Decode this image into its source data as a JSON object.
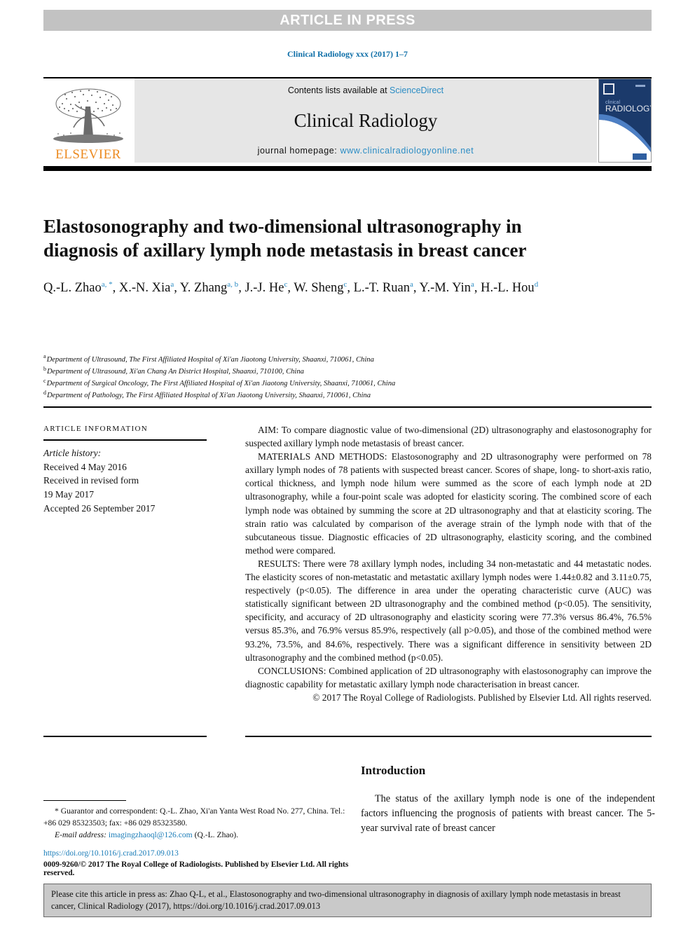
{
  "banner": {
    "text": "ARTICLE IN PRESS"
  },
  "running_head": "Clinical Radiology xxx (2017) 1–7",
  "masthead": {
    "publisher_name": "ELSEVIER",
    "contents_prefix": "Contents lists available at ",
    "contents_link": "ScienceDirect",
    "journal_name": "Clinical Radiology",
    "homepage_prefix": "journal homepage: ",
    "homepage_link": "www.clinicalradiologyonline.net",
    "cover": {
      "line1": "clinical",
      "line2": "RADIOLOGY"
    },
    "link_color": "#2b8cc4",
    "elsevier_orange": "#ec8b22",
    "cover_navy": "#1b3a6b"
  },
  "article": {
    "title": "Elastosonography and two-dimensional ultrasonography in diagnosis of axillary lymph node metastasis in breast cancer",
    "authors_line1": "Q.-L. Zhao",
    "authors": [
      {
        "name": "Q.-L. Zhao",
        "marks": "a, *"
      },
      {
        "name": "X.-N. Xia",
        "marks": "a"
      },
      {
        "name": "Y. Zhang",
        "marks": "a, b"
      },
      {
        "name": "J.-J. He",
        "marks": "c"
      },
      {
        "name": "W. Sheng",
        "marks": "c"
      },
      {
        "name": "L.-T. Ruan",
        "marks": "a"
      },
      {
        "name": "Y.-M. Yin",
        "marks": "a"
      },
      {
        "name": "H.-L. Hou",
        "marks": "d"
      }
    ],
    "affiliations": [
      {
        "mark": "a",
        "text": "Department of Ultrasound, The First Affiliated Hospital of Xi'an Jiaotong University, Shaanxi, 710061, China"
      },
      {
        "mark": "b",
        "text": "Department of Ultrasound, Xi'an Chang An District Hospital, Shaanxi, 710100, China"
      },
      {
        "mark": "c",
        "text": "Department of Surgical Oncology, The First Affiliated Hospital of Xi'an Jiaotong University, Shaanxi, 710061, China"
      },
      {
        "mark": "d",
        "text": "Department of Pathology, The First Affiliated Hospital of Xi'an Jiaotong University, Shaanxi, 710061, China"
      }
    ]
  },
  "article_information": {
    "heading": "ARTICLE INFORMATION",
    "history_label": "Article history:",
    "received": "Received 4 May 2016",
    "revised_label": "Received in revised form",
    "revised_date": "19 May 2017",
    "accepted": "Accepted 26 September 2017"
  },
  "abstract": {
    "aim_label": "AIM:",
    "aim_text": " To compare diagnostic value of two-dimensional (2D) ultrasonography and elastosonography for suspected axillary lymph node metastasis of breast cancer.",
    "methods_label": "MATERIALS AND METHODS:",
    "methods_text": " Elastosonography and 2D ultrasonography were performed on 78 axillary lymph nodes of 78 patients with suspected breast cancer. Scores of shape, long- to short-axis ratio, cortical thickness, and lymph node hilum were summed as the score of each lymph node at 2D ultrasonography, while a four-point scale was adopted for elasticity scoring. The combined score of each lymph node was obtained by summing the score at 2D ultrasonography and that at elasticity scoring. The strain ratio was calculated by comparison of the average strain of the lymph node with that of the subcutaneous tissue. Diagnostic efficacies of 2D ultrasonography, elasticity scoring, and the combined method were compared.",
    "results_label": "RESULTS:",
    "results_text": " There were 78 axillary lymph nodes, including 34 non-metastatic and 44 metastatic nodes. The elasticity scores of non-metastatic and metastatic axillary lymph nodes were 1.44±0.82 and 3.11±0.75, respectively (p<0.05). The difference in area under the operating characteristic curve (AUC) was statistically significant between 2D ultrasonography and the combined method (p<0.05). The sensitivity, specificity, and accuracy of 2D ultrasonography and elasticity scoring were 77.3% versus 86.4%, 76.5% versus 85.3%, and 76.9% versus 85.9%, respectively (all p>0.05), and those of the combined method were 93.2%, 73.5%, and 84.6%, respectively. There was a significant difference in sensitivity between 2D ultrasonography and the combined method (p<0.05).",
    "conclusions_label": "CONCLUSIONS:",
    "conclusions_text": " Combined application of 2D ultrasonography with elastosonography can improve the diagnostic capability for metastatic axillary lymph node characterisation in breast cancer.",
    "copyright": "© 2017 The Royal College of Radiologists. Published by Elsevier Ltd. All rights reserved."
  },
  "introduction": {
    "heading": "Introduction",
    "paragraph": "The status of the axillary lymph node is one of the independent factors influencing the prognosis of patients with breast cancer. The 5-year survival rate of breast cancer"
  },
  "footnote": {
    "correspondence": "* Guarantor and correspondent: Q.-L. Zhao, Xi'an Yanta West Road No. 277, China. Tel.: +86 029 85323503; fax: +86 029 85323580.",
    "email_label": "E-mail address:",
    "email": "imagingzhaoql@126.com",
    "email_suffix": "(Q.-L. Zhao).",
    "doi": "https://doi.org/10.1016/j.crad.2017.09.013",
    "issn_line": "0009-9260/© 2017 The Royal College of Radiologists. Published by Elsevier Ltd. All rights reserved."
  },
  "citation_box": {
    "text": "Please cite this article in press as: Zhao Q-L, et al., Elastosonography and two-dimensional ultrasonography in diagnosis of axillary lymph node metastasis in breast cancer, Clinical Radiology (2017), https://doi.org/10.1016/j.crad.2017.09.013"
  }
}
